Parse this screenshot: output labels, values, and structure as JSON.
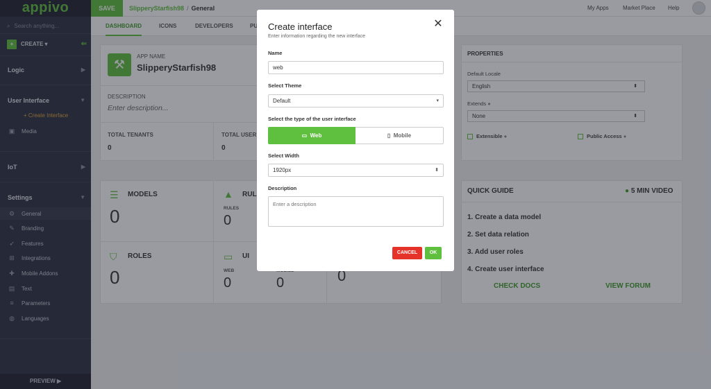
{
  "app": {
    "logo": "appivo"
  },
  "sidebar": {
    "search_placeholder": "Search anything...",
    "create_label": "CREATE",
    "sections": {
      "logic": "Logic",
      "user_interface": "User Interface",
      "iot": "IoT",
      "settings": "Settings"
    },
    "ui_items": {
      "create_interface": "+ Create Interface",
      "media": "Media"
    },
    "settings_items": [
      "General",
      "Branding",
      "Features",
      "Integrations",
      "Mobile Addons",
      "Text",
      "Parameters",
      "Languages"
    ],
    "preview_label": "PREVIEW ▶"
  },
  "topbar": {
    "save_label": "SAVE",
    "app_name": "SlipperyStarfish98",
    "separator": "/",
    "page": "General",
    "nav": [
      "My Apps",
      "Market Place",
      "Help"
    ]
  },
  "tabs": [
    "DASHBOARD",
    "ICONS",
    "DEVELOPERS",
    "PU"
  ],
  "dashboard": {
    "app_name_label": "APP NAME",
    "app_name": "SlipperyStarfish98",
    "description_label": "DESCRIPTION",
    "description_placeholder": "Enter description...",
    "total_tenants_label": "TOTAL TENANTS",
    "total_tenants": "0",
    "total_users_label": "TOTAL USER",
    "total_users": "0",
    "models_label": "MODELS",
    "models": "0",
    "rules_label": "RUL",
    "rules_sub": "RULES",
    "rules": "0",
    "roles_label": "ROLES",
    "roles": "0",
    "ui_label": "UI",
    "ui_web_label": "WEB",
    "ui_web": "0",
    "ui_mobile_label": "MOBILE",
    "ui_mobile": "0",
    "extra_value": "0"
  },
  "properties": {
    "title": "PROPERTIES",
    "locale_label": "Default Locale",
    "locale": "English",
    "extends_label": "Extends",
    "extends": "None",
    "extensible_label": "Extensible",
    "public_access_label": "Public Access"
  },
  "quick_guide": {
    "title": "QUICK GUIDE",
    "video_label": "5 MIN VIDEO",
    "steps": [
      "1. Create a data model",
      "2. Set data relation",
      "3. Add user roles",
      "4. Create user interface"
    ],
    "check_docs": "CHECK DOCS",
    "view_forum": "VIEW FORUM"
  },
  "modal": {
    "title": "Create interface",
    "subtitle": "Enter information regarding the new interface",
    "name_label": "Name",
    "name_value": "web",
    "theme_label": "Select Theme",
    "theme_value": "Default",
    "type_label": "Select the type of the user interface",
    "type_web": "Web",
    "type_mobile": "Mobile",
    "width_label": "Select Width",
    "width_value": "1920px",
    "description_label": "Description",
    "description_placeholder": "Enter a description",
    "cancel_label": "CANCEL",
    "ok_label": "OK"
  },
  "colors": {
    "accent": "#5fbf3f",
    "sidebar": "#2d3142",
    "danger": "#e5332a"
  }
}
